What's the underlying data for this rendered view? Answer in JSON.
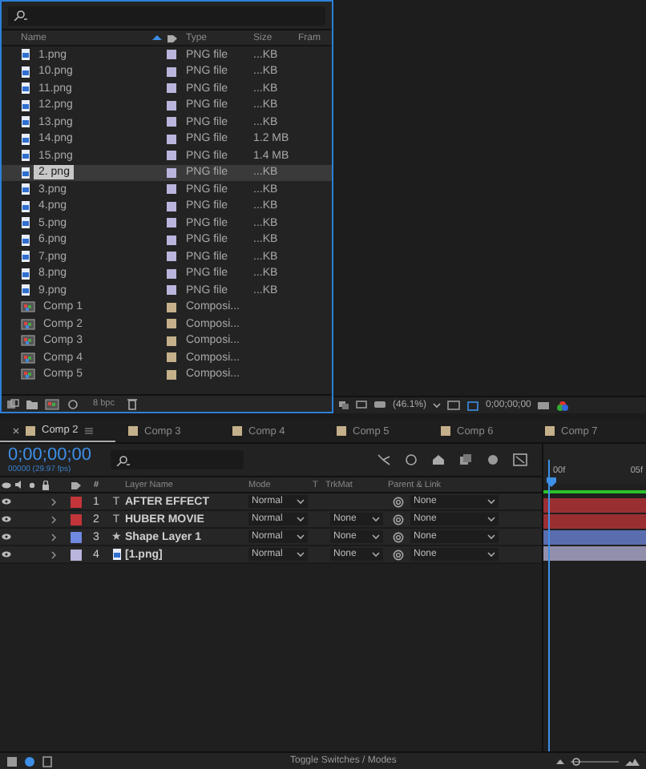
{
  "project": {
    "columns": [
      "Name",
      "Type",
      "Size",
      "Fram"
    ],
    "items": [
      {
        "name": "1.png",
        "kind": "png",
        "color": "#b9b5dc",
        "type": "PNG file",
        "size": "...KB",
        "selected": false
      },
      {
        "name": "10.png",
        "kind": "png",
        "color": "#b9b5dc",
        "type": "PNG file",
        "size": "...KB",
        "selected": false
      },
      {
        "name": "11.png",
        "kind": "png",
        "color": "#b9b5dc",
        "type": "PNG file",
        "size": "...KB",
        "selected": false
      },
      {
        "name": "12.png",
        "kind": "png",
        "color": "#b9b5dc",
        "type": "PNG file",
        "size": "...KB",
        "selected": false
      },
      {
        "name": "13.png",
        "kind": "png",
        "color": "#b9b5dc",
        "type": "PNG file",
        "size": "...KB",
        "selected": false
      },
      {
        "name": "14.png",
        "kind": "png",
        "color": "#b9b5dc",
        "type": "PNG file",
        "size": "1.2 MB",
        "selected": false
      },
      {
        "name": "15.png",
        "kind": "png",
        "color": "#b9b5dc",
        "type": "PNG file",
        "size": "1.4 MB",
        "selected": false
      },
      {
        "name": "2. png",
        "kind": "png",
        "color": "#b9b5dc",
        "type": "PNG file",
        "size": "...KB",
        "selected": true
      },
      {
        "name": "3.png",
        "kind": "png",
        "color": "#b9b5dc",
        "type": "PNG file",
        "size": "...KB",
        "selected": false
      },
      {
        "name": "4.png",
        "kind": "png",
        "color": "#b9b5dc",
        "type": "PNG file",
        "size": "...KB",
        "selected": false
      },
      {
        "name": "5.png",
        "kind": "png",
        "color": "#b9b5dc",
        "type": "PNG file",
        "size": "...KB",
        "selected": false
      },
      {
        "name": "6.png",
        "kind": "png",
        "color": "#b9b5dc",
        "type": "PNG file",
        "size": "...KB",
        "selected": false
      },
      {
        "name": "7.png",
        "kind": "png",
        "color": "#b9b5dc",
        "type": "PNG file",
        "size": "...KB",
        "selected": false
      },
      {
        "name": "8.png",
        "kind": "png",
        "color": "#b9b5dc",
        "type": "PNG file",
        "size": "...KB",
        "selected": false
      },
      {
        "name": "9.png",
        "kind": "png",
        "color": "#b9b5dc",
        "type": "PNG file",
        "size": "...KB",
        "selected": false
      },
      {
        "name": "Comp 1",
        "kind": "comp",
        "color": "#c4b08a",
        "type": "Composi...",
        "selected": false
      },
      {
        "name": "Comp 2",
        "kind": "comp",
        "color": "#c4b08a",
        "type": "Composi...",
        "selected": false
      },
      {
        "name": "Comp 3",
        "kind": "comp",
        "color": "#c4b08a",
        "type": "Composi...",
        "selected": false
      },
      {
        "name": "Comp 4",
        "kind": "comp",
        "color": "#c4b08a",
        "type": "Composi...",
        "selected": false
      },
      {
        "name": "Comp 5",
        "kind": "comp",
        "color": "#c4b08a",
        "type": "Composi...",
        "selected": false
      }
    ],
    "bpc": "8 bpc"
  },
  "viewer": {
    "zoom": "(46.1%)",
    "timecode": "0;00;00;00"
  },
  "tabs": [
    {
      "label": "Comp 2",
      "color": "#c4b08a",
      "selected": true
    },
    {
      "label": "Comp 3",
      "color": "#c4b08a",
      "selected": false
    },
    {
      "label": "Comp 4",
      "color": "#c4b08a",
      "selected": false
    },
    {
      "label": "Comp 5",
      "color": "#c4b08a",
      "selected": false
    },
    {
      "label": "Comp 6",
      "color": "#c4b08a",
      "selected": false
    },
    {
      "label": "Comp 7",
      "color": "#c4b08a",
      "selected": false
    }
  ],
  "timeline": {
    "timecode": "0;00;00;00",
    "fps": "00000 (29.97 fps)",
    "columns": {
      "number": "#",
      "name": "Layer Name",
      "mode": "Mode",
      "t": "T",
      "trkmat": "TrkMat",
      "parent": "Parent & Link"
    },
    "ruler": [
      "00f",
      "05f"
    ],
    "layers": [
      {
        "number": "1",
        "kind": "text",
        "icon": "T",
        "name": "AFTER EFFECT",
        "color": "#c4353a",
        "mode": "Normal",
        "parent": "None"
      },
      {
        "number": "2",
        "kind": "text",
        "icon": "T",
        "name": "HUBER MOVIE",
        "color": "#c4353a",
        "mode": "Normal",
        "trkmat": "None",
        "parent": "None"
      },
      {
        "number": "3",
        "kind": "shape",
        "icon": "★",
        "name": "Shape Layer 1",
        "color": "#6f88e0",
        "mode": "Normal",
        "trkmat": "None",
        "parent": "None"
      },
      {
        "number": "4",
        "kind": "footage",
        "name": "[1.png]",
        "color": "#b9b5dc",
        "mode": "Normal",
        "trkmat": "None",
        "parent": "None"
      }
    ],
    "toggle": "Toggle Switches / Modes",
    "zoom": {
      "level": 0.1
    }
  }
}
